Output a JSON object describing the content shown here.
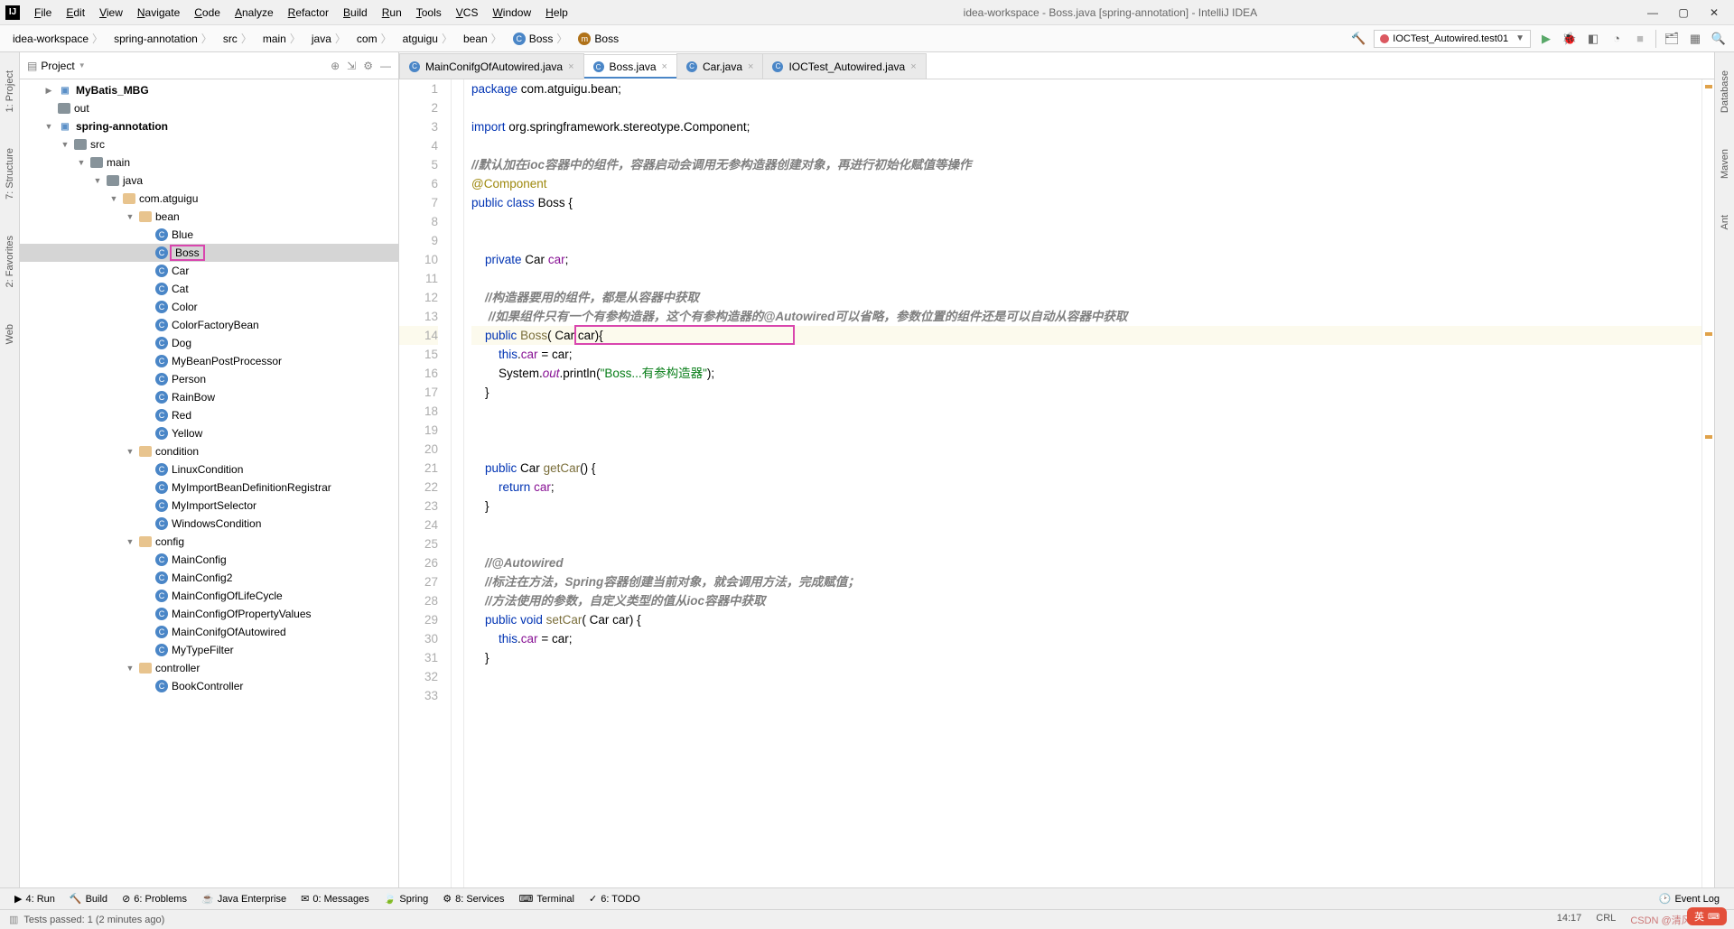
{
  "window": {
    "title": "idea-workspace - Boss.java [spring-annotation] - IntelliJ IDEA"
  },
  "menubar": [
    "File",
    "Edit",
    "View",
    "Navigate",
    "Code",
    "Analyze",
    "Refactor",
    "Build",
    "Run",
    "Tools",
    "VCS",
    "Window",
    "Help"
  ],
  "breadcrumb": [
    {
      "label": "idea-workspace",
      "icon": ""
    },
    {
      "label": "spring-annotation",
      "icon": ""
    },
    {
      "label": "src",
      "icon": ""
    },
    {
      "label": "main",
      "icon": ""
    },
    {
      "label": "java",
      "icon": ""
    },
    {
      "label": "com",
      "icon": ""
    },
    {
      "label": "atguigu",
      "icon": ""
    },
    {
      "label": "bean",
      "icon": ""
    },
    {
      "label": "Boss",
      "icon": "class"
    },
    {
      "label": "Boss",
      "icon": "method"
    }
  ],
  "run_config": "IOCTest_Autowired.test01",
  "project": {
    "title": "Project",
    "tree": [
      {
        "depth": 1,
        "toggle": "▶",
        "icon": "module",
        "label": "MyBatis_MBG",
        "bold": true
      },
      {
        "depth": 1,
        "toggle": "",
        "icon": "folder",
        "label": "out"
      },
      {
        "depth": 1,
        "toggle": "▼",
        "icon": "module",
        "label": "spring-annotation",
        "bold": true
      },
      {
        "depth": 2,
        "toggle": "▼",
        "icon": "folder",
        "label": "src"
      },
      {
        "depth": 3,
        "toggle": "▼",
        "icon": "folder",
        "label": "main"
      },
      {
        "depth": 4,
        "toggle": "▼",
        "icon": "folder",
        "label": "java"
      },
      {
        "depth": 5,
        "toggle": "▼",
        "icon": "package",
        "label": "com.atguigu"
      },
      {
        "depth": 6,
        "toggle": "▼",
        "icon": "package",
        "label": "bean"
      },
      {
        "depth": 7,
        "toggle": "",
        "icon": "java",
        "label": "Blue"
      },
      {
        "depth": 7,
        "toggle": "",
        "icon": "java",
        "label": "Boss",
        "selected": true,
        "highlight": true
      },
      {
        "depth": 7,
        "toggle": "",
        "icon": "java",
        "label": "Car"
      },
      {
        "depth": 7,
        "toggle": "",
        "icon": "java",
        "label": "Cat"
      },
      {
        "depth": 7,
        "toggle": "",
        "icon": "java",
        "label": "Color"
      },
      {
        "depth": 7,
        "toggle": "",
        "icon": "java",
        "label": "ColorFactoryBean"
      },
      {
        "depth": 7,
        "toggle": "",
        "icon": "java",
        "label": "Dog"
      },
      {
        "depth": 7,
        "toggle": "",
        "icon": "java",
        "label": "MyBeanPostProcessor"
      },
      {
        "depth": 7,
        "toggle": "",
        "icon": "java",
        "label": "Person"
      },
      {
        "depth": 7,
        "toggle": "",
        "icon": "java",
        "label": "RainBow"
      },
      {
        "depth": 7,
        "toggle": "",
        "icon": "java",
        "label": "Red"
      },
      {
        "depth": 7,
        "toggle": "",
        "icon": "java",
        "label": "Yellow"
      },
      {
        "depth": 6,
        "toggle": "▼",
        "icon": "package",
        "label": "condition"
      },
      {
        "depth": 7,
        "toggle": "",
        "icon": "java",
        "label": "LinuxCondition"
      },
      {
        "depth": 7,
        "toggle": "",
        "icon": "java",
        "label": "MyImportBeanDefinitionRegistrar"
      },
      {
        "depth": 7,
        "toggle": "",
        "icon": "java",
        "label": "MyImportSelector"
      },
      {
        "depth": 7,
        "toggle": "",
        "icon": "java",
        "label": "WindowsCondition"
      },
      {
        "depth": 6,
        "toggle": "▼",
        "icon": "package",
        "label": "config"
      },
      {
        "depth": 7,
        "toggle": "",
        "icon": "java",
        "label": "MainConfig"
      },
      {
        "depth": 7,
        "toggle": "",
        "icon": "java",
        "label": "MainConfig2"
      },
      {
        "depth": 7,
        "toggle": "",
        "icon": "java",
        "label": "MainConfigOfLifeCycle"
      },
      {
        "depth": 7,
        "toggle": "",
        "icon": "java",
        "label": "MainConfigOfPropertyValues"
      },
      {
        "depth": 7,
        "toggle": "",
        "icon": "java",
        "label": "MainConifgOfAutowired"
      },
      {
        "depth": 7,
        "toggle": "",
        "icon": "java",
        "label": "MyTypeFilter"
      },
      {
        "depth": 6,
        "toggle": "▼",
        "icon": "package",
        "label": "controller"
      },
      {
        "depth": 7,
        "toggle": "",
        "icon": "java",
        "label": "BookController"
      }
    ]
  },
  "tabs": [
    {
      "label": "MainConifgOfAutowired.java",
      "active": false
    },
    {
      "label": "Boss.java",
      "active": true
    },
    {
      "label": "Car.java",
      "active": false
    },
    {
      "label": "IOCTest_Autowired.java",
      "active": false
    }
  ],
  "code": {
    "lines": [
      {
        "n": 1,
        "html": "<span class='kw'>package</span> com.atguigu.bean;"
      },
      {
        "n": 2,
        "html": ""
      },
      {
        "n": 3,
        "html": "<span class='kw'>import</span> org.springframework.stereotype.<span class='type'>Component</span>;"
      },
      {
        "n": 4,
        "html": ""
      },
      {
        "n": 5,
        "html": "<span class='cmt-cn'>//默认加在ioc容器中的组件，容器启动会调用无参构造器创建对象，再进行初始化赋值等操作</span>"
      },
      {
        "n": 6,
        "html": "<span class='ann'>@Component</span>"
      },
      {
        "n": 7,
        "html": "<span class='kw'>public</span> <span class='kw'>class</span> Boss {"
      },
      {
        "n": 8,
        "html": ""
      },
      {
        "n": 9,
        "html": ""
      },
      {
        "n": 10,
        "html": "    <span class='kw'>private</span> Car <span class='field'>car</span>;"
      },
      {
        "n": 11,
        "html": ""
      },
      {
        "n": 12,
        "html": "    <span class='cmt-cn'>//构造器要用的组件，都是从容器中获取</span>"
      },
      {
        "n": 13,
        "html": "     <span class='cmt-cn'>//如果组件只有一个有参构造器，这个有参构造器的@Autowired可以省略，参数位置的组件还是可以自动从容器中获取</span>"
      },
      {
        "n": 14,
        "html": "    <span class='kw'>public</span> <span class='method'>Boss</span>( Car <span class='param'>car</span>){",
        "cur": true
      },
      {
        "n": 15,
        "html": "        <span class='kw'>this</span>.<span class='field'>car</span> = car;"
      },
      {
        "n": 16,
        "html": "        System.<span class='static'>out</span>.println(<span class='str'>\"Boss...有参构造器\"</span>);"
      },
      {
        "n": 17,
        "html": "    }"
      },
      {
        "n": 18,
        "html": ""
      },
      {
        "n": 19,
        "html": ""
      },
      {
        "n": 20,
        "html": ""
      },
      {
        "n": 21,
        "html": "    <span class='kw'>public</span> Car <span class='method'>getCar</span>() {"
      },
      {
        "n": 22,
        "html": "        <span class='kw'>return</span> <span class='field'>car</span>;"
      },
      {
        "n": 23,
        "html": "    }"
      },
      {
        "n": 24,
        "html": ""
      },
      {
        "n": 25,
        "html": ""
      },
      {
        "n": 26,
        "html": "    <span class='cmt-cn'>//@Autowired</span>"
      },
      {
        "n": 27,
        "html": "    <span class='cmt-cn'>//标注在方法，Spring容器创建当前对象，就会调用方法，完成赋值；</span>"
      },
      {
        "n": 28,
        "html": "    <span class='cmt-cn'>//方法使用的参数，自定义类型的值从ioc容器中获取</span>"
      },
      {
        "n": 29,
        "html": "    <span class='kw'>public</span> <span class='kw'>void</span> <span class='method'>setCar</span>( Car car) {"
      },
      {
        "n": 30,
        "html": "        <span class='kw'>this</span>.<span class='field'>car</span> = car;"
      },
      {
        "n": 31,
        "html": "    }"
      },
      {
        "n": 32,
        "html": ""
      },
      {
        "n": 33,
        "html": ""
      }
    ]
  },
  "left_stripe": [
    "1: Project",
    "7: Structure",
    "2: Favorites",
    "Web"
  ],
  "right_stripe": [
    "Database",
    "Maven",
    "Ant"
  ],
  "bottom_tabs": [
    "4: Run",
    "Build",
    "6: Problems",
    "Java Enterprise",
    "0: Messages",
    "Spring",
    "8: Services",
    "Terminal",
    "6: TODO"
  ],
  "bottom_right": "Event Log",
  "status": {
    "left": "Tests passed: 1 (2 minutes ago)",
    "pos": "14:17",
    "enc": "CRL",
    "lang": "英"
  },
  "watermark": "CSDN @清风微凉 aa"
}
